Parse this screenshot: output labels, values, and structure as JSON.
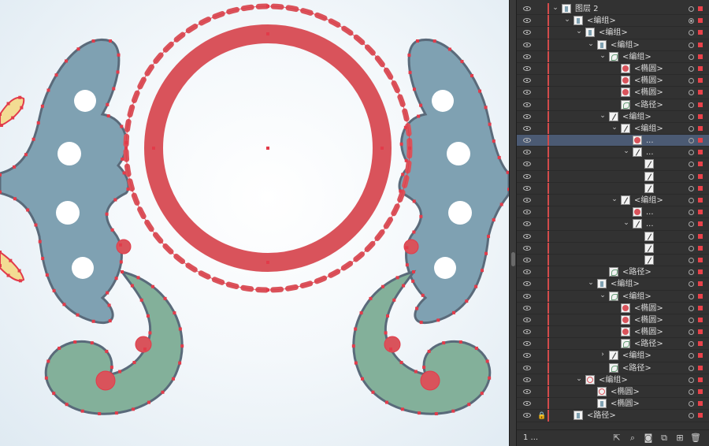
{
  "colors": {
    "ring": "#d9535b",
    "scroll_blue": "#7fa1b2",
    "scroll_green": "#83b09a",
    "scroll_yellow": "#f3dc93",
    "outline": "#5a6a7a",
    "anchor": "#e23b4a",
    "panel_bg": "#323232",
    "selected_row": "#4b5a73",
    "layer_color": "#d34b4b"
  },
  "layers_panel": {
    "rows": [
      {
        "indent": 0,
        "caret": "v",
        "thumb": "grp",
        "label": "图层 2",
        "target": "empty",
        "selsq": true,
        "lock": false
      },
      {
        "indent": 1,
        "caret": "v",
        "thumb": "grp",
        "label": "<编组>",
        "target": "filled",
        "selsq": true,
        "lock": false
      },
      {
        "indent": 2,
        "caret": "v",
        "thumb": "grp",
        "label": "<编组>",
        "target": "empty",
        "selsq": true,
        "lock": false
      },
      {
        "indent": 3,
        "caret": "v",
        "thumb": "grp",
        "label": "<编组>",
        "target": "empty",
        "selsq": true,
        "lock": false
      },
      {
        "indent": 4,
        "caret": "v",
        "thumb": "path",
        "label": "<编组>",
        "target": "empty",
        "selsq": true,
        "lock": false
      },
      {
        "indent": 5,
        "caret": "",
        "thumb": "ell",
        "label": "<椭圆>",
        "target": "empty",
        "selsq": true,
        "lock": false
      },
      {
        "indent": 5,
        "caret": "",
        "thumb": "ell",
        "label": "<椭圆>",
        "target": "empty",
        "selsq": true,
        "lock": false
      },
      {
        "indent": 5,
        "caret": "",
        "thumb": "ell",
        "label": "<椭圆>",
        "target": "empty",
        "selsq": true,
        "lock": false
      },
      {
        "indent": 5,
        "caret": "",
        "thumb": "path",
        "label": "<路径>",
        "target": "empty",
        "selsq": true,
        "lock": false
      },
      {
        "indent": 4,
        "caret": "v",
        "thumb": "line",
        "label": "<编组>",
        "target": "empty",
        "selsq": true,
        "lock": false
      },
      {
        "indent": 5,
        "caret": "v",
        "thumb": "line",
        "label": "<编组>",
        "target": "empty",
        "selsq": true,
        "lock": false
      },
      {
        "indent": 6,
        "caret": "",
        "thumb": "ell",
        "label": "...",
        "target": "empty",
        "selsq": true,
        "lock": false,
        "selected": true
      },
      {
        "indent": 6,
        "caret": "v",
        "thumb": "line",
        "label": "...",
        "target": "empty",
        "selsq": true,
        "lock": false
      },
      {
        "indent": 7,
        "caret": "",
        "thumb": "line",
        "label": "",
        "target": "empty",
        "selsq": true,
        "lock": false
      },
      {
        "indent": 7,
        "caret": "",
        "thumb": "line",
        "label": "",
        "target": "empty",
        "selsq": true,
        "lock": false
      },
      {
        "indent": 7,
        "caret": "",
        "thumb": "line",
        "label": "",
        "target": "empty",
        "selsq": true,
        "lock": false
      },
      {
        "indent": 5,
        "caret": "v",
        "thumb": "line",
        "label": "<编组>",
        "target": "empty",
        "selsq": true,
        "lock": false
      },
      {
        "indent": 6,
        "caret": "",
        "thumb": "ell",
        "label": "...",
        "target": "empty",
        "selsq": true,
        "lock": false
      },
      {
        "indent": 6,
        "caret": "v",
        "thumb": "line",
        "label": "...",
        "target": "empty",
        "selsq": true,
        "lock": false
      },
      {
        "indent": 7,
        "caret": "",
        "thumb": "line",
        "label": "",
        "target": "empty",
        "selsq": true,
        "lock": false
      },
      {
        "indent": 7,
        "caret": "",
        "thumb": "line",
        "label": "",
        "target": "empty",
        "selsq": true,
        "lock": false
      },
      {
        "indent": 7,
        "caret": "",
        "thumb": "line",
        "label": "",
        "target": "empty",
        "selsq": true,
        "lock": false
      },
      {
        "indent": 4,
        "caret": "",
        "thumb": "path",
        "label": "<路径>",
        "target": "empty",
        "selsq": true,
        "lock": false
      },
      {
        "indent": 3,
        "caret": "v",
        "thumb": "grp",
        "label": "<编组>",
        "target": "empty",
        "selsq": true,
        "lock": false
      },
      {
        "indent": 4,
        "caret": "v",
        "thumb": "path",
        "label": "<编组>",
        "target": "empty",
        "selsq": true,
        "lock": false
      },
      {
        "indent": 5,
        "caret": "",
        "thumb": "ell",
        "label": "<椭圆>",
        "target": "empty",
        "selsq": true,
        "lock": false
      },
      {
        "indent": 5,
        "caret": "",
        "thumb": "ell",
        "label": "<椭圆>",
        "target": "empty",
        "selsq": true,
        "lock": false
      },
      {
        "indent": 5,
        "caret": "",
        "thumb": "ell",
        "label": "<椭圆>",
        "target": "empty",
        "selsq": true,
        "lock": false
      },
      {
        "indent": 5,
        "caret": "",
        "thumb": "path",
        "label": "<路径>",
        "target": "empty",
        "selsq": true,
        "lock": false
      },
      {
        "indent": 4,
        "caret": ">",
        "thumb": "line",
        "label": "<编组>",
        "target": "empty",
        "selsq": true,
        "lock": false
      },
      {
        "indent": 4,
        "caret": "",
        "thumb": "path",
        "label": "<路径>",
        "target": "empty",
        "selsq": true,
        "lock": false
      },
      {
        "indent": 2,
        "caret": "v",
        "thumb": "ring",
        "label": "<编组>",
        "target": "empty",
        "selsq": true,
        "lock": false
      },
      {
        "indent": 3,
        "caret": "",
        "thumb": "ring",
        "label": "<椭圆>",
        "target": "empty",
        "selsq": true,
        "lock": false
      },
      {
        "indent": 3,
        "caret": "",
        "thumb": "grp",
        "label": "<椭圆>",
        "target": "empty",
        "selsq": true,
        "lock": false
      },
      {
        "indent": 1,
        "caret": "",
        "thumb": "grp",
        "label": "<路径>",
        "target": "empty",
        "selsq": true,
        "lock": true
      }
    ]
  },
  "footer": {
    "layer_count": "1 ...",
    "buttons": [
      {
        "name": "export-icon",
        "glyph": "⇱"
      },
      {
        "name": "locate-object-icon",
        "glyph": "⌕"
      },
      {
        "name": "make-clipping-mask-icon",
        "glyph": "◙"
      },
      {
        "name": "create-sublayer-icon",
        "glyph": "⧉"
      },
      {
        "name": "new-layer-icon",
        "glyph": "⊞"
      },
      {
        "name": "delete-layer-icon",
        "glyph": "🗑"
      }
    ]
  }
}
